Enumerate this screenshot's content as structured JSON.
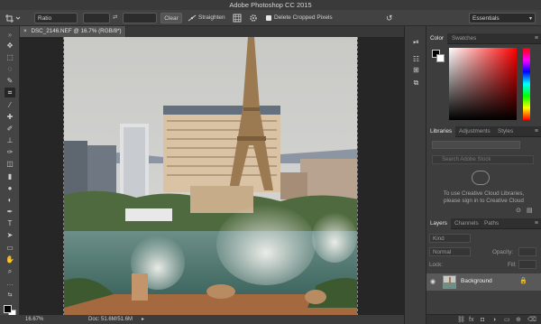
{
  "app": {
    "title": "Adobe Photoshop CC 2015"
  },
  "options_bar": {
    "ratio": "Ratio",
    "clear": "Clear",
    "straighten": "Straighten",
    "delete_cropped": "Delete Cropped Pixels",
    "workspace": "Essentials"
  },
  "document": {
    "tab_label": "DSC_2146.NEF @ 16.7% (RGB/8*)",
    "close_glyph": "×"
  },
  "status_bar": {
    "zoom": "16.67%",
    "doc": "Doc: 51.6M/51.6M"
  },
  "panels": {
    "color_tabs": [
      "Color",
      "Swatches"
    ],
    "library_tabs": [
      "Libraries",
      "Adjustments",
      "Styles"
    ],
    "library_search_placeholder": "Search Adobe Stock",
    "library_message_1": "To use Creative Cloud Libraries,",
    "library_message_2": "please sign in to Creative Cloud",
    "layer_tabs": [
      "Layers",
      "Channels",
      "Paths"
    ],
    "kind": "Kind",
    "blend": "Normal",
    "opacity_label": "Opacity:",
    "lock_label": "Lock:",
    "fill_label": "Fill:",
    "layer_name": "Background"
  },
  "colors": {
    "accent": "#ff0000",
    "panel_bg": "#3d3d3d",
    "canvas_bg": "#262626"
  },
  "icons": {
    "move": "move-icon",
    "marquee": "marquee-icon",
    "lasso": "lasso-icon",
    "quick_select": "quick-select-icon",
    "crop": "crop-icon",
    "eyedropper": "eyedropper-icon",
    "healing": "healing-brush-icon",
    "brush": "brush-icon",
    "stamp": "clone-stamp-icon",
    "history": "history-brush-icon",
    "eraser": "eraser-icon",
    "gradient": "gradient-icon",
    "blur": "blur-icon",
    "dodge": "dodge-icon",
    "pen": "pen-icon",
    "type": "type-icon",
    "path_select": "path-select-icon",
    "shape": "shape-icon",
    "hand": "hand-icon",
    "zoom": "zoom-icon"
  }
}
